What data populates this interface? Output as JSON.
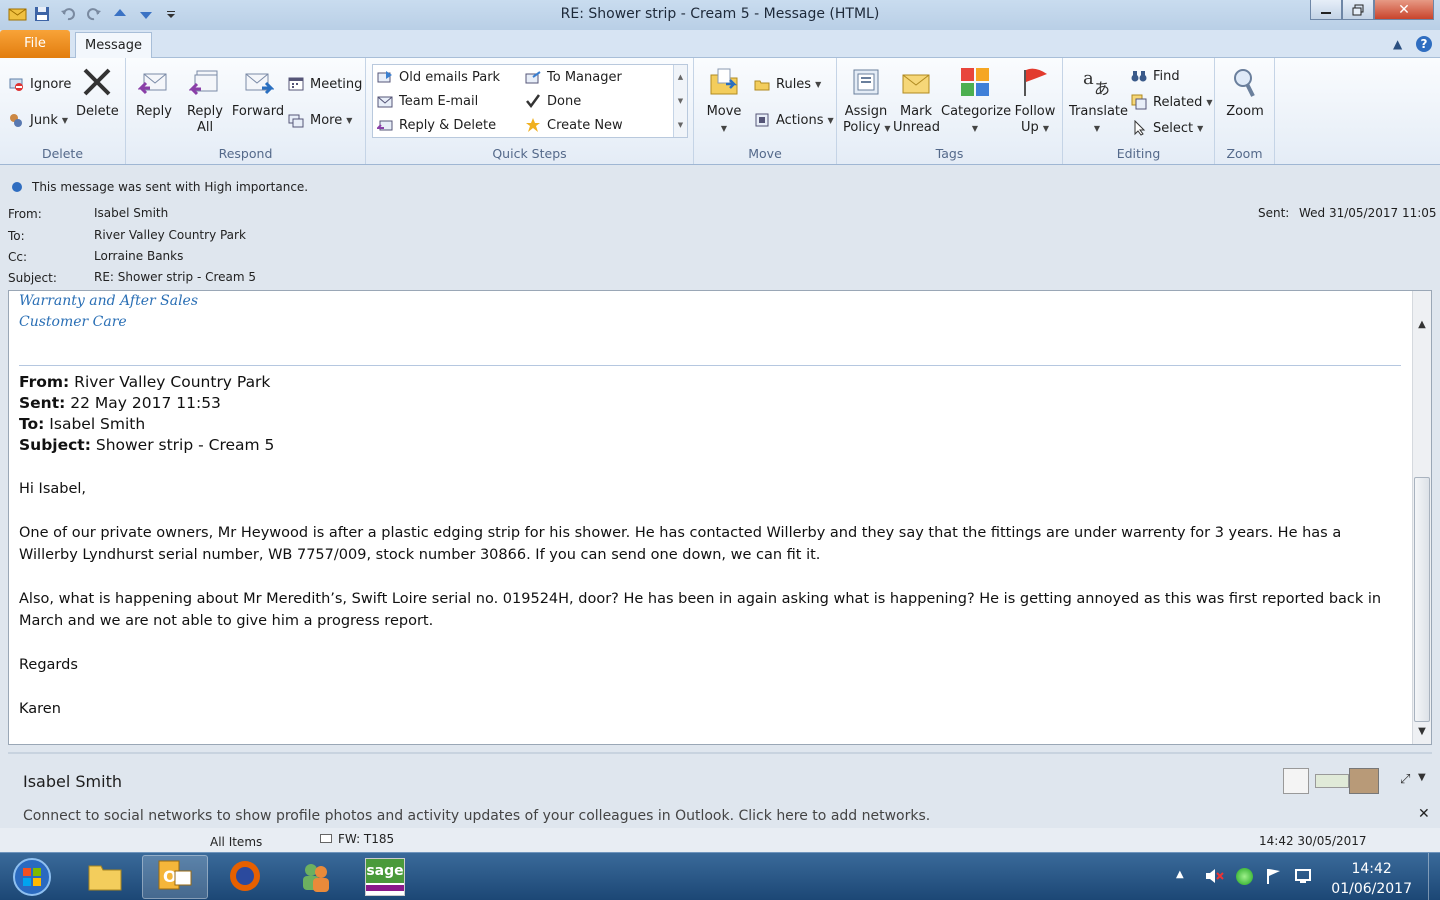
{
  "window": {
    "title": "RE: Shower strip - Cream 5  -  Message (HTML)"
  },
  "tabs": {
    "file": "File",
    "message": "Message"
  },
  "ribbon": {
    "delete_group": {
      "label": "Delete",
      "ignore": "Ignore",
      "junk": "Junk",
      "delete": "Delete"
    },
    "respond_group": {
      "label": "Respond",
      "reply": "Reply",
      "reply_all_1": "Reply",
      "reply_all_2": "All",
      "forward": "Forward",
      "meeting": "Meeting",
      "more": "More"
    },
    "quicksteps_group": {
      "label": "Quick Steps",
      "items": [
        "Old emails Park",
        "Team E-mail",
        "Reply & Delete",
        "To Manager",
        "Done",
        "Create New"
      ]
    },
    "move_group": {
      "label": "Move",
      "move": "Move",
      "rules": "Rules",
      "actions": "Actions"
    },
    "tags_group": {
      "label": "Tags",
      "assign_1": "Assign",
      "assign_2": "Policy",
      "mark_1": "Mark",
      "mark_2": "Unread",
      "categorize": "Categorize",
      "follow_1": "Follow",
      "follow_2": "Up"
    },
    "editing_group": {
      "label": "Editing",
      "translate": "Translate",
      "find": "Find",
      "related": "Related",
      "select": "Select"
    },
    "zoom_group": {
      "label": "Zoom",
      "zoom": "Zoom"
    }
  },
  "header": {
    "importance": "This message was sent with High importance.",
    "from_label": "From:",
    "from": "Isabel Smith",
    "to_label": "To:",
    "to": "River Valley Country Park",
    "cc_label": "Cc:",
    "cc": "Lorraine Banks",
    "subject_label": "Subject:",
    "subject": "RE: Shower strip - Cream 5",
    "sent_label": "Sent:",
    "sent": "Wed 31/05/2017 11:05"
  },
  "body": {
    "sig_line1": "Warranty and After Sales",
    "sig_line2": "Customer Care",
    "quoted": {
      "from_label": "From:",
      "from": " River Valley Country Park",
      "sent_label": "Sent:",
      "sent": " 22 May 2017 11:53",
      "to_label": "To:",
      "to": " Isabel Smith",
      "subject_label": "Subject:",
      "subject": " Shower strip - Cream 5"
    },
    "greeting": "Hi Isabel,",
    "para1": "One of our private owners, Mr Heywood is after a plastic edging strip for his shower.  He has contacted Willerby and they say that the fittings are under warrenty for 3 years.  He has a Willerby Lyndhurst serial number, WB 7757/009, stock number 30866.  If you can send one down, we can fit it.",
    "para2": "Also, what is happening about Mr Meredith’s, Swift Loire serial no. 019524H, door?  He has been in again asking what is happening?  He is getting annoyed as this was first reported back in March and we are not able to give him a progress report.",
    "regards": "Regards",
    "signoff": "Karen"
  },
  "people_pane": {
    "name": "Isabel Smith",
    "connect": "Connect to social networks to show profile photos and activity updates of your colleagues in Outlook. Click here to add networks."
  },
  "behind": {
    "folder": "All Items",
    "item": "FW: T185",
    "time": "14:42 30/05/2017"
  },
  "taskbar": {
    "time": "14:42",
    "date": "01/06/2017",
    "sage": "sage"
  },
  "colors": {
    "accent": "#e27d0f",
    "signature": "#2a6fb5",
    "taskbar": "#1c4775"
  }
}
